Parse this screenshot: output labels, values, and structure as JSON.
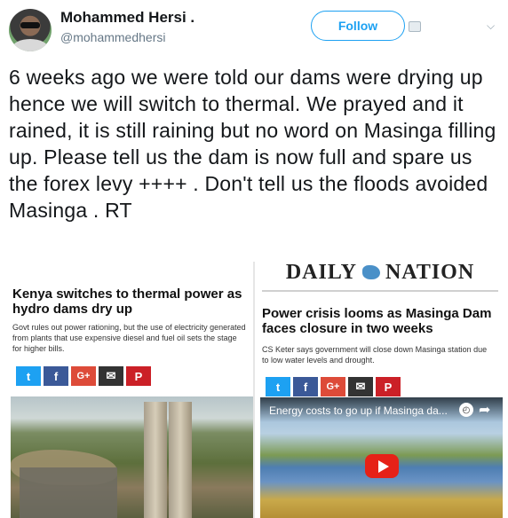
{
  "author": {
    "name": "Mohammed Hersi .",
    "handle": "@mohammedhersi"
  },
  "actions": {
    "follow_label": "Follow"
  },
  "tweet": {
    "text": "6 weeks ago we were told our dams were drying up hence we will switch to thermal. We prayed and it rained,  it is still raining but no word on Masinga filling up.  Please tell us the dam is now full and spare us the forex levy ++++ . Don't tell us the floods avoided Masinga . RT"
  },
  "media": {
    "left_article": {
      "headline": "Kenya switches to thermal power as hydro dams dry up",
      "subtext": "Govt rules out power rationing, but the use of electricity generated from plants that use expensive diesel and fuel oil sets the stage for higher bills."
    },
    "right_article": {
      "masthead_left": "DAILY",
      "masthead_right": "NATION",
      "headline": "Power crisis looms as Masinga Dam faces closure in two weeks",
      "subtext": "CS Keter says government will close down Masinga station due to low water levels and drought.",
      "video_title": "Energy costs to go up if Masinga da..."
    },
    "share_buttons": [
      "t",
      "f",
      "G+",
      "✉",
      "P"
    ]
  },
  "colors": {
    "accent": "#1da1f2",
    "twitter": "#1da1f2",
    "facebook": "#3b5998",
    "googleplus": "#dd4b39",
    "email": "#333333",
    "pinterest": "#cb2027",
    "youtube": "#e62117"
  }
}
